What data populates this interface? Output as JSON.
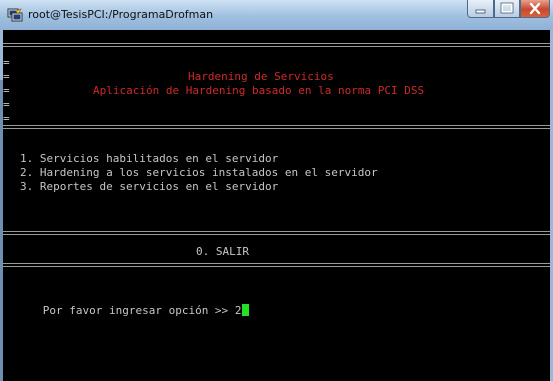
{
  "window": {
    "title": "root@TesisPCI:/ProgramaDrofman"
  },
  "icons": {
    "app": "putty-icon",
    "minimize": "minimize-icon",
    "maximize": "maximize-icon",
    "close": "close-icon"
  },
  "terminal": {
    "border_marks": [
      "=",
      "=",
      "=",
      "=",
      "="
    ],
    "header_title": "Hardening de Servicios",
    "header_subtitle": "Aplicación de Hardening basado en la norma PCI DSS",
    "menu_items": [
      "1. Servicios habilitados en el servidor",
      "2. Hardening a los servicios instalados en el servidor",
      "3. Reportes de servicios en el servidor"
    ],
    "exit_option": "0. SALIR",
    "prompt": "Por favor ingresar opción >> ",
    "input_value": "2"
  }
}
